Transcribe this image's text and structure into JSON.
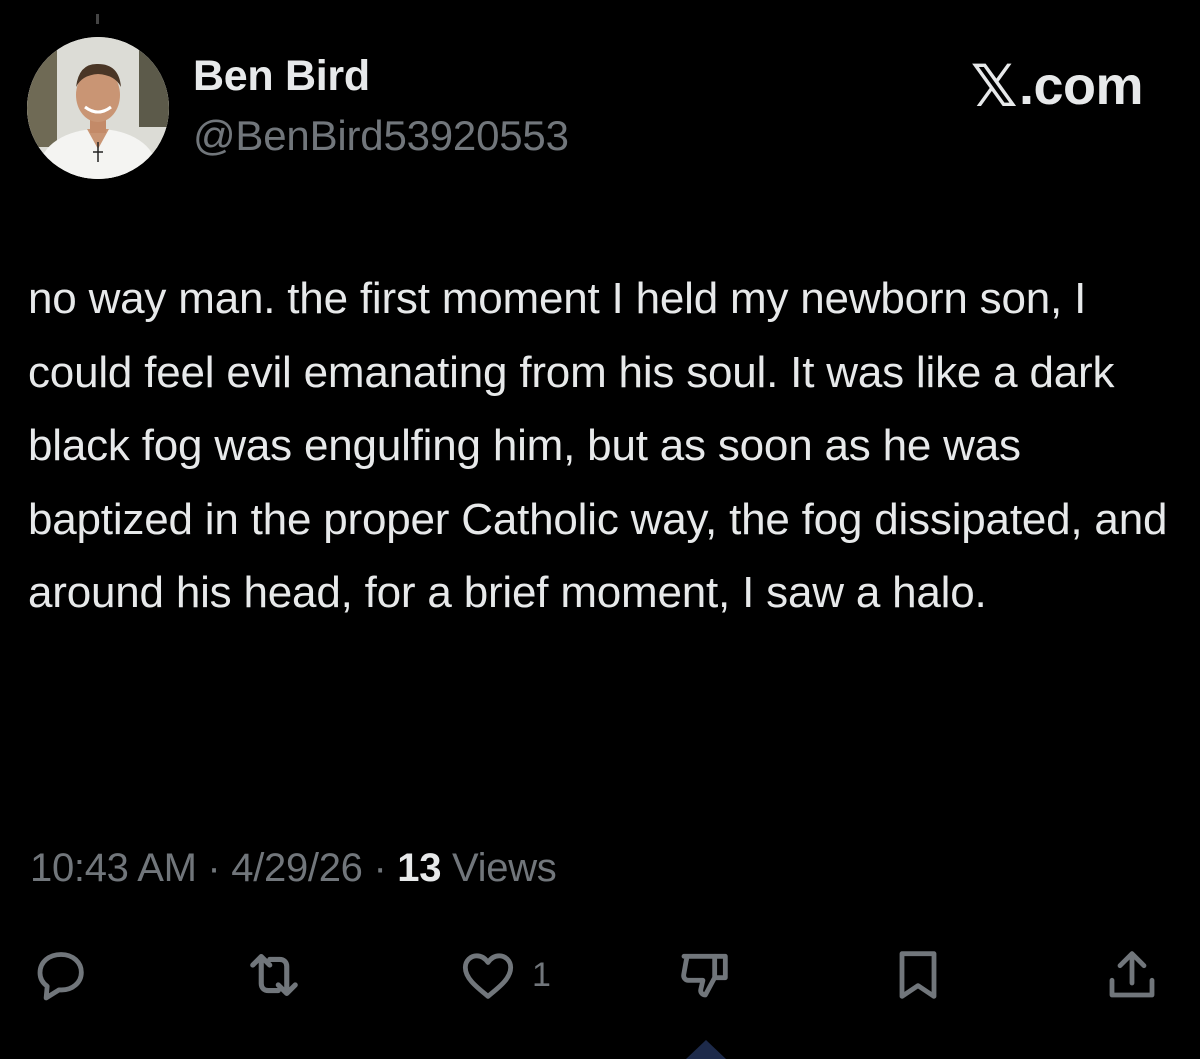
{
  "author": {
    "display_name": "Ben Bird",
    "handle": "@BenBird53920553"
  },
  "brand": {
    "x_mark": "𝕏",
    "label": ".com"
  },
  "tweet": {
    "text": "no way man. the first moment I held my newborn son, I could feel evil emanating from his soul. It was like a dark black fog was engulfing him, but as soon as he was baptized in the proper Catholic way, the fog dissipated, and around his head, for a brief moment, I saw a halo."
  },
  "meta": {
    "time": "10:43 AM",
    "separator": " · ",
    "date": "4/29/26",
    "views_count": "13",
    "views_label": " Views"
  },
  "actions": {
    "reply": {
      "icon": "reply-icon"
    },
    "repost": {
      "icon": "repost-icon"
    },
    "like": {
      "icon": "heart-icon",
      "count": "1"
    },
    "dislike": {
      "icon": "thumbs-down-icon"
    },
    "bookmark": {
      "icon": "bookmark-icon"
    },
    "share": {
      "icon": "share-icon"
    }
  },
  "colors": {
    "background": "#000000",
    "primary_text": "#e7e9ea",
    "secondary_text": "#71767b"
  }
}
